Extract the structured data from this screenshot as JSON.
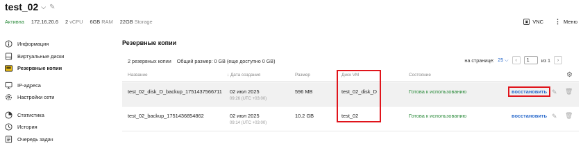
{
  "header": {
    "vm_name": "test_02",
    "chevron": "chevron-down-icon",
    "edit_icon": "pencil-icon"
  },
  "meta": {
    "status": "Активна",
    "ip": "172.16.20.6",
    "vcpu_num": "2",
    "vcpu_unit": "vCPU",
    "ram_num": "6GB",
    "ram_unit": "RAM",
    "storage_num": "22GB",
    "storage_unit": "Storage"
  },
  "top_actions": {
    "vnc_label": "VNC",
    "menu_label": "Меню"
  },
  "sidebar": {
    "items": [
      {
        "label": "Информация",
        "icon": "info-icon"
      },
      {
        "label": "Виртуальные диски",
        "icon": "disk-icon"
      },
      {
        "label": "Резервные копии",
        "icon": "backup-icon",
        "active": true
      },
      {
        "label": "IP-адреса",
        "icon": "ip-icon"
      },
      {
        "label": "Настройки сети",
        "icon": "network-settings-icon"
      },
      {
        "label": "Статистика",
        "icon": "stats-icon"
      },
      {
        "label": "История",
        "icon": "history-icon"
      },
      {
        "label": "Очередь задач",
        "icon": "task-queue-icon"
      }
    ]
  },
  "backups": {
    "title": "Резервные копии",
    "count_text": "2 резервных копии",
    "size_text": "Общий размер: 0 GB (еще доступно 0 GB)",
    "per_page_label": "на странице:",
    "per_page_value": "25",
    "page_current": "1",
    "page_of": "из 1",
    "columns": [
      "Название",
      "↓ Дата создания",
      "Размер",
      "Диск VM",
      "Состояние"
    ],
    "rows": [
      {
        "name": "test_02_disk_D_backup_1751437566711",
        "date": "02 июл 2025",
        "time": "09:26 (UTC +03:00)",
        "size": "596 MB",
        "disk": "test_02_disk_D",
        "state": "Готова к использованию",
        "action": "восстановить"
      },
      {
        "name": "test_02_backup_1751436854862",
        "date": "02 июл 2025",
        "time": "09:14 (UTC +03:00)",
        "size": "10.2 GB",
        "disk": "test_02",
        "state": "Готова к использованию",
        "action": "восстановить"
      }
    ]
  },
  "colors": {
    "accent": "#2a6acb",
    "status_ok": "#2a8a3a",
    "highlight_box": "#e0141b"
  }
}
